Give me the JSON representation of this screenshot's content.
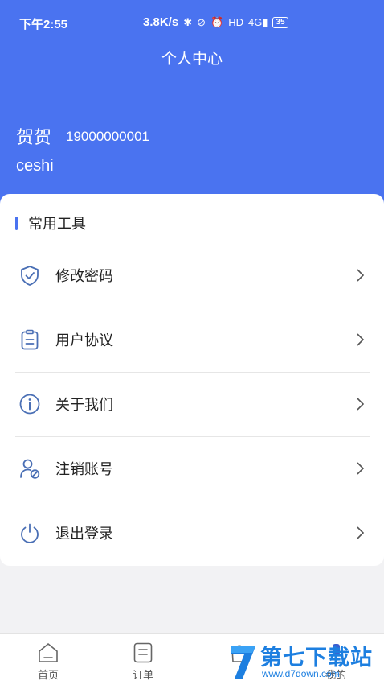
{
  "status_bar": {
    "time": "下午2:55",
    "speed": "3.8K/s",
    "network": "4G",
    "battery": "35"
  },
  "header": {
    "title": "个人中心"
  },
  "user": {
    "name": "贺贺",
    "phone": "19000000001",
    "description": "ceshi"
  },
  "tools": {
    "section_title": "常用工具",
    "items": [
      {
        "label": "修改密码",
        "icon": "shield-check-icon"
      },
      {
        "label": "用户协议",
        "icon": "clipboard-icon"
      },
      {
        "label": "关于我们",
        "icon": "info-icon"
      },
      {
        "label": "注销账号",
        "icon": "user-cancel-icon"
      },
      {
        "label": "退出登录",
        "icon": "power-icon"
      }
    ]
  },
  "tabbar": {
    "items": [
      {
        "label": "首页",
        "icon": "home-icon"
      },
      {
        "label": "订单",
        "icon": "order-icon"
      },
      {
        "label": "",
        "icon": "bag-icon"
      },
      {
        "label": "我的",
        "icon": "profile-icon"
      }
    ]
  },
  "watermark": {
    "main": "第七下载站",
    "sub": "www.d7down.com"
  },
  "colors": {
    "primary": "#4a73f0",
    "icon": "#4a6fb5",
    "watermark": "#1d7fe0"
  }
}
